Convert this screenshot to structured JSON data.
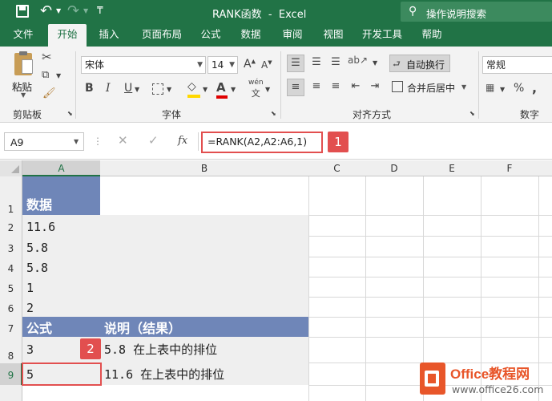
{
  "title": "RANK函数  -  Excel",
  "search_placeholder": "操作说明搜索",
  "tabs": [
    "文件",
    "开始",
    "插入",
    "页面布局",
    "公式",
    "数据",
    "审阅",
    "视图",
    "开发工具",
    "帮助"
  ],
  "ribbon": {
    "paste_label": "粘贴",
    "clipboard_label": "剪贴板",
    "font_name": "宋体",
    "font_size": "14",
    "font_group_label": "字体",
    "bold": "B",
    "italic": "I",
    "underline": "U",
    "wrap_text": "自动换行",
    "merge_center": "合并后居中",
    "align_group_label": "对齐方式",
    "number_format": "常规",
    "number_group_label": "数字",
    "font_grow": "A",
    "font_shrink": "A",
    "font_color_letter": "A",
    "phonetic": "wén"
  },
  "formula_bar": {
    "name_box": "A9",
    "fx": "fx",
    "formula": "=RANK(A2,A2:A6,1)"
  },
  "columns": [
    "A",
    "B",
    "C",
    "D",
    "E",
    "F"
  ],
  "rows": [
    "1",
    "2",
    "3",
    "4",
    "5",
    "6",
    "7",
    "8",
    "9"
  ],
  "cells": {
    "A1": "数据",
    "A2": "11.6",
    "A3": "5.8",
    "A4": "5.8",
    "A5": "1",
    "A6": "2",
    "A7": "公式",
    "B7": "说明（结果）",
    "A8": "3",
    "B8": "5.8 在上表中的排位",
    "A9": "5",
    "B9": "11.6 在上表中的排位"
  },
  "badges": [
    "1",
    "2"
  ],
  "watermark": {
    "brand": "Office教程网",
    "url": "www.office26.com"
  },
  "colors": {
    "excel_green": "#217346",
    "header_blue": "#6f86b8",
    "light_gray": "#efefef",
    "badge_red": "#e24f4f",
    "logo_orange": "#e8562a"
  }
}
